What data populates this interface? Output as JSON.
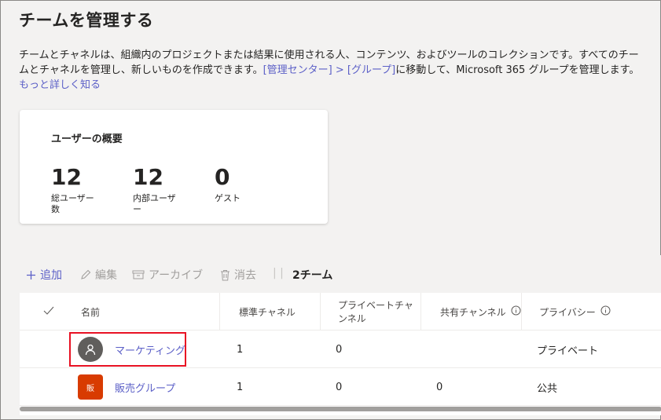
{
  "page": {
    "title": "チームを管理する",
    "description_prefix": "チームとチャネルは、組織内のプロジェクトまたは結果に使用される人、コンテンツ、およびツールのコレクションです。すべてのチームとチャネルを管理し、新しいものを作成できます。",
    "description_nav": "[管理センター] > [グループ]",
    "description_suffix": "に移動して、Microsoft 365 グループを管理します。",
    "more_link": "もっと詳しく知る"
  },
  "overview": {
    "title": "ユーザーの概要",
    "metrics": [
      {
        "value": "12",
        "label_line1": "総ユーザー",
        "label_line2": "数"
      },
      {
        "value": "12",
        "label_line1": "内部ユーザ",
        "label_line2": "ー"
      },
      {
        "value": "0",
        "label_line1": "ゲスト",
        "label_line2": ""
      }
    ]
  },
  "toolbar": {
    "add": "追加",
    "edit": "編集",
    "archive": "アーカイブ",
    "delete": "消去",
    "separator": "| |",
    "count": "2チーム"
  },
  "table": {
    "columns": {
      "name": "名前",
      "standard": "標準チャネル",
      "private": "プライベートチャンネル",
      "shared": "共有チャンネル",
      "privacy": "プライバシー"
    },
    "rows": [
      {
        "name": "マーケティング",
        "avatar_icon": "person-icon",
        "standard": "1",
        "private": "0",
        "shared": "",
        "privacy": "プライベート"
      },
      {
        "name": "販売グループ",
        "avatar_text": "販",
        "standard": "1",
        "private": "0",
        "shared": "0",
        "privacy": "公共"
      }
    ]
  },
  "colors": {
    "accent": "#5b5fc7",
    "highlight": "#e81123",
    "group_avatar": "#d83b01",
    "person_avatar": "#605e5c"
  }
}
